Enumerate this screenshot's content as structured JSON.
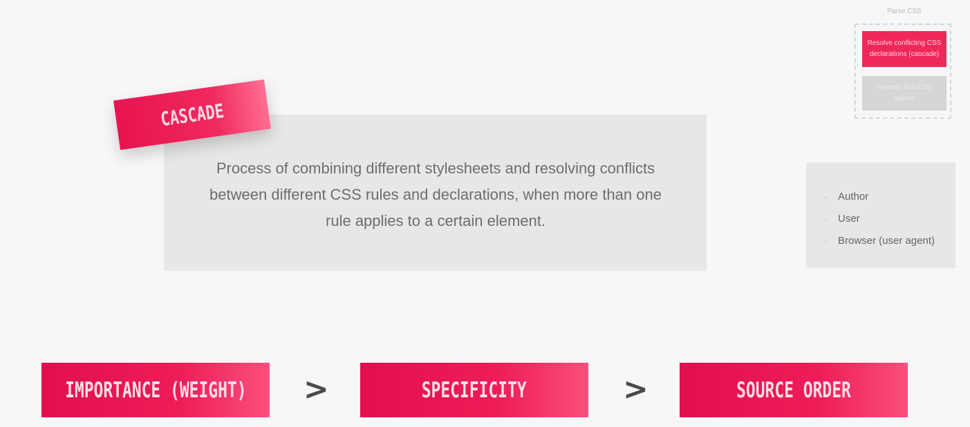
{
  "parse_css": {
    "label": "Parse CSS",
    "active_step": "Resolve conflicting CSS declarations (cascade)",
    "inactive_step": "Process final CSS values"
  },
  "cascade": {
    "tag": "CASCADE",
    "definition": "Process of combining different stylesheets and resolving conflicts between different CSS rules and declarations, when more than one rule applies to a certain element."
  },
  "sources": {
    "bullet": "·",
    "items": [
      "Author",
      "User",
      "Browser (user agent)"
    ]
  },
  "priority": {
    "items": [
      "IMPORTANCE (WEIGHT)",
      "SPECIFICITY",
      "SOURCE ORDER"
    ],
    "separator": ">"
  },
  "colors": {
    "accent": "#f0285a",
    "panel": "#e7e7e7",
    "background": "#f7f6f8"
  }
}
